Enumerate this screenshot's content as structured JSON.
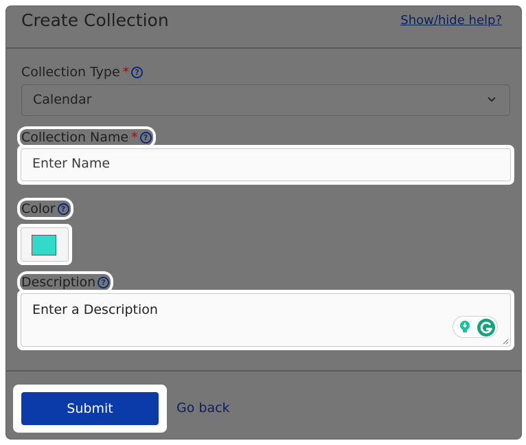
{
  "header": {
    "title": "Create Collection",
    "help_link": "Show/hide help?"
  },
  "form": {
    "collection_type": {
      "label": "Collection Type",
      "required_mark": "*",
      "value": "Calendar"
    },
    "collection_name": {
      "label": "Collection Name",
      "required_mark": "*",
      "placeholder": "Enter Name"
    },
    "color": {
      "label": "Color",
      "value": "#33d9c9"
    },
    "description": {
      "label": "Description",
      "placeholder": "Enter a Description"
    }
  },
  "help_icon_glyph": "?",
  "actions": {
    "submit_label": "Submit",
    "goback_label": "Go back"
  },
  "colors": {
    "accent": "#0a3ba8",
    "required": "#b3000c",
    "grammarly": "#15c39a"
  }
}
